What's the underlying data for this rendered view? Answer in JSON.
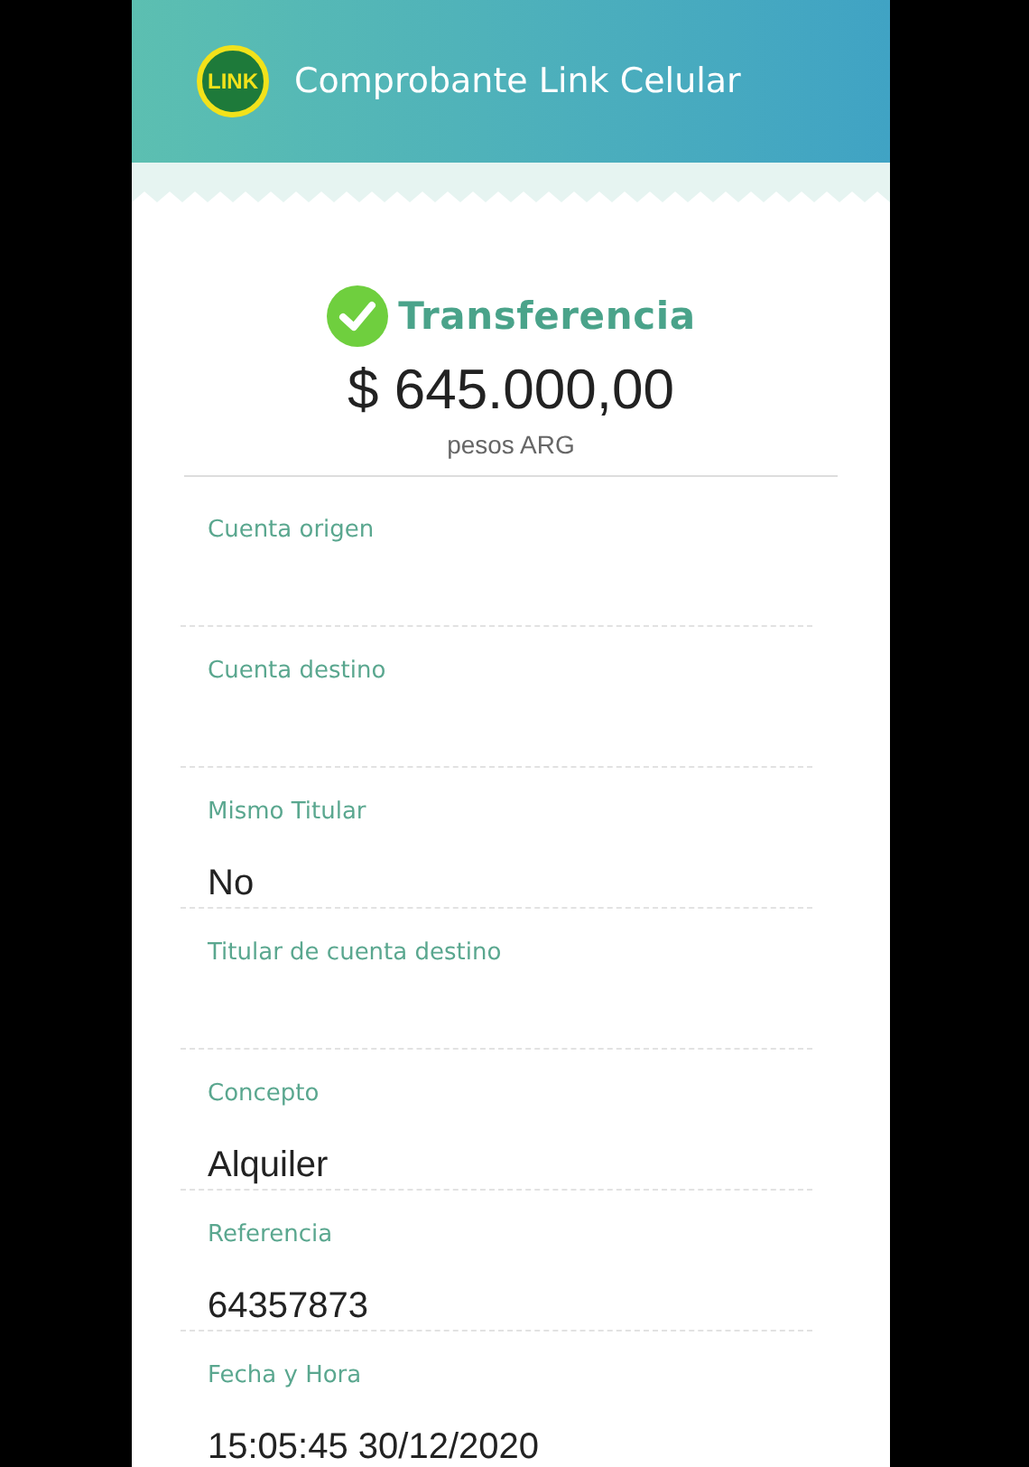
{
  "header": {
    "logo_text": "LINK",
    "title": "Comprobante Link Celular"
  },
  "summary": {
    "completed": true,
    "operation": "Transferencia",
    "amount": "$ 645.000,00",
    "currency": "pesos ARG"
  },
  "fields": [
    {
      "label": "Cuenta origen"
    },
    {
      "label": "Cuenta destino"
    },
    {
      "label": "Mismo Titular",
      "value": "No"
    },
    {
      "label": "Titular de cuenta destino"
    },
    {
      "label": "Concepto",
      "value": "Alquiler"
    },
    {
      "label": "Referencia",
      "value": "64357873"
    },
    {
      "label": "Fecha y Hora",
      "value": "15:05:45 30/12/2020"
    }
  ]
}
